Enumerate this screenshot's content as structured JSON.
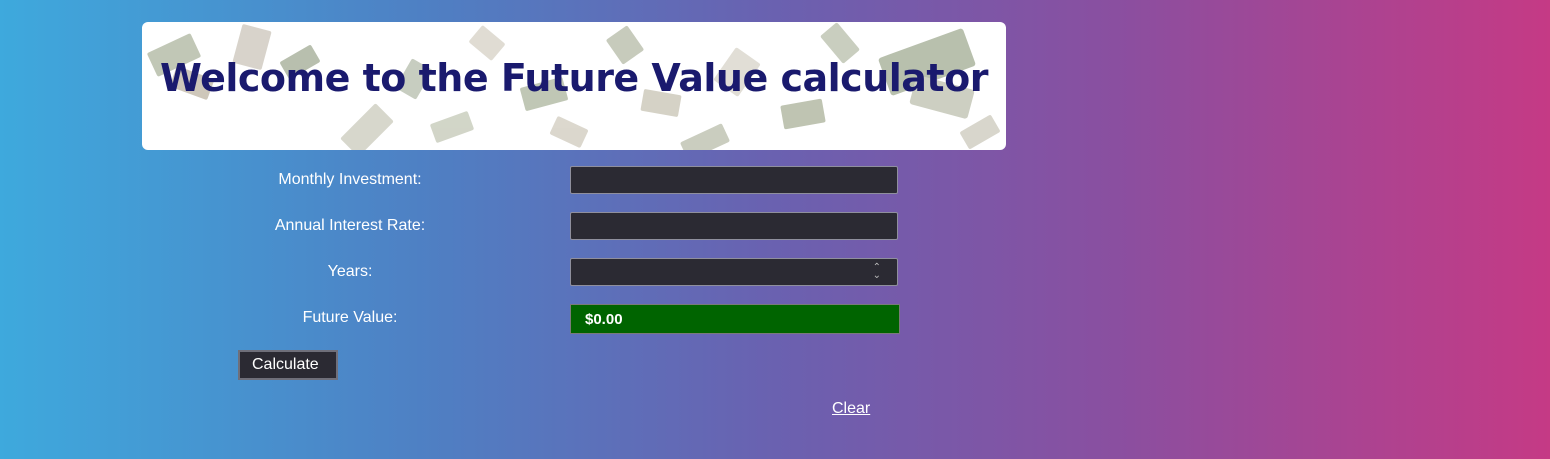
{
  "header": {
    "title": "Welcome to the Future Value calculator"
  },
  "form": {
    "monthly_investment": {
      "label": "Monthly Investment:",
      "value": ""
    },
    "annual_interest_rate": {
      "label": "Annual Interest Rate:",
      "value": ""
    },
    "years": {
      "label": "Years:",
      "value": ""
    },
    "future_value": {
      "label": "Future Value:",
      "value": "$0.00"
    }
  },
  "actions": {
    "calculate_label": "Calculate",
    "clear_label": "Clear"
  },
  "colors": {
    "title": "#1a1a6e",
    "field_bg": "#2b2a33",
    "result_bg": "#006400",
    "gradient_start": "#3ea9dd",
    "gradient_end": "#c53a85"
  },
  "icons": {
    "banner_background": "flying-money-image",
    "years_control": "spinner-icon"
  }
}
